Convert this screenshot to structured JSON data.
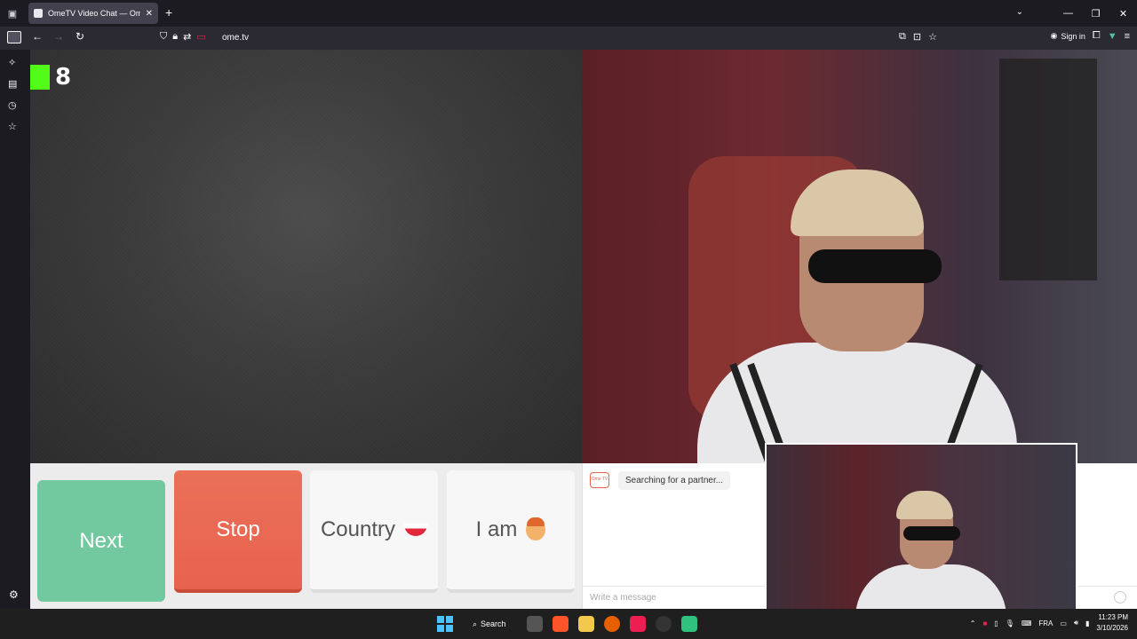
{
  "browser": {
    "tab_title": "OmeTV Video Chat — Ome",
    "url": "ome.tv",
    "signin_label": "Sign in",
    "new_tab_glyph": "+",
    "close_glyph": "✕"
  },
  "stream": {
    "viewer_count": "8"
  },
  "controls": {
    "next_label": "Next",
    "stop_label": "Stop",
    "country_label": "Country",
    "iam_label": "I am"
  },
  "chat": {
    "logo_text": "Ome TV",
    "status": "Searching for a partner...",
    "input_placeholder": "Write a message"
  },
  "taskbar": {
    "search_label": "Search",
    "language": "FRA",
    "time": "11:23 PM",
    "date": "3/10/2026"
  },
  "colors": {
    "next": "#72c9a0",
    "stop": "#e8634d",
    "kick_green": "#53fc18"
  }
}
